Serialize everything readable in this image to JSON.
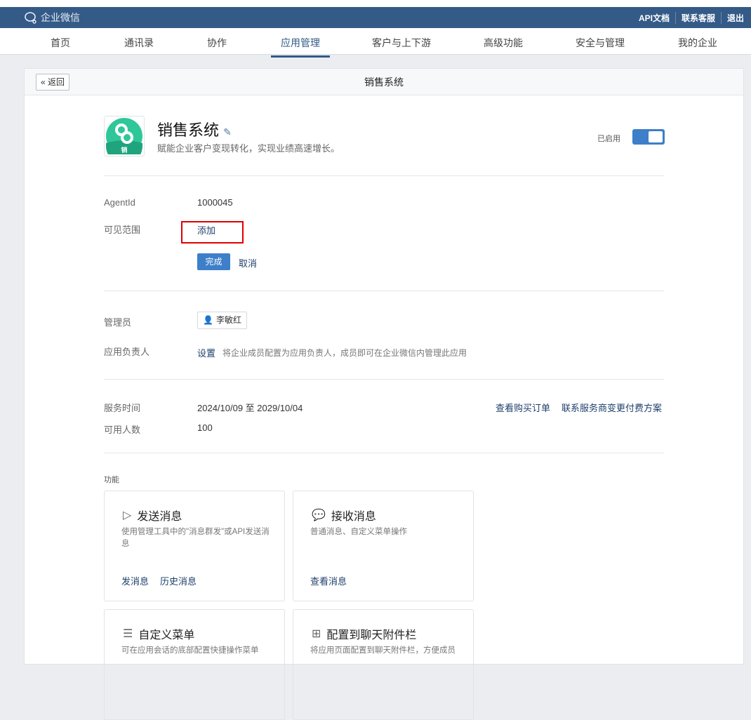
{
  "header": {
    "brand": "企业微信",
    "links": [
      "API文档",
      "联系客服",
      "退出"
    ]
  },
  "nav": {
    "items": [
      "首页",
      "通讯录",
      "协作",
      "应用管理",
      "客户与上下游",
      "高级功能",
      "安全与管理",
      "我的企业"
    ],
    "active": 3
  },
  "page": {
    "back": "返回",
    "title": "销售系统"
  },
  "app": {
    "name": "销售系统",
    "desc": "赋能企业客户变现转化，实现业绩高速增长。",
    "icon_text": "销",
    "status": "已启用",
    "enabled": true
  },
  "info": {
    "agentid_label": "AgentId",
    "agentid": "1000045",
    "scope_label": "可见范围",
    "scope_add": "添加",
    "done": "完成",
    "cancel": "取消"
  },
  "admin": {
    "label": "管理员",
    "name": "李敏红",
    "owner_label": "应用负责人",
    "owner_set": "设置",
    "owner_hint": "将企业成员配置为应用负责人，成员即可在企业微信内管理此应用"
  },
  "service": {
    "time_label": "服务时间",
    "time": "2024/10/09 至 2029/10/04",
    "count_label": "可用人数",
    "count": "100",
    "order_link": "查看购买订单",
    "contact_link": "联系服务商变更付费方案"
  },
  "features": {
    "label": "功能",
    "cards": [
      {
        "title": "发送消息",
        "desc": "使用管理工具中的\"消息群发\"或API发送消息",
        "links": [
          "发消息",
          "历史消息"
        ]
      },
      {
        "title": "接收消息",
        "desc": "普通消息、自定义菜单操作",
        "links": [
          "查看消息"
        ]
      },
      {
        "title": "自定义菜单",
        "desc": "可在应用会话的底部配置快捷操作菜单",
        "links": []
      },
      {
        "title": "配置到聊天附件栏",
        "desc": "将应用页面配置到聊天附件栏，方便成员",
        "links": []
      }
    ]
  },
  "colors": {
    "header": "#345a87",
    "accent": "#3d7fc9",
    "app_icon": "#2fc79a",
    "highlight": "#e00000"
  }
}
